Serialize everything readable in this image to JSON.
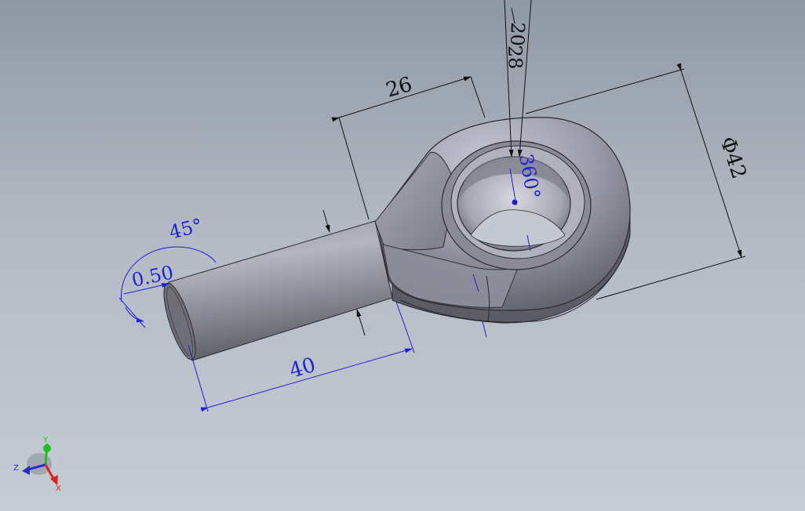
{
  "colors": {
    "dimension_black": "#111111",
    "dimension_blue": "#1f1fd6",
    "axis_x": "#e02020",
    "axis_y": "#1fbf1f",
    "axis_z": "#2a2ad8"
  },
  "dimensions": {
    "neck_length": "26",
    "bore_a": "28",
    "bore_b": "20",
    "head_diameter": "Φ42",
    "shank_length": "40",
    "chamfer_distance": "0.50",
    "chamfer_angle": "45°",
    "revolve_angle": "360°"
  },
  "triad": {
    "x_label": "X",
    "y_label": "Y",
    "z_label": "Z"
  }
}
